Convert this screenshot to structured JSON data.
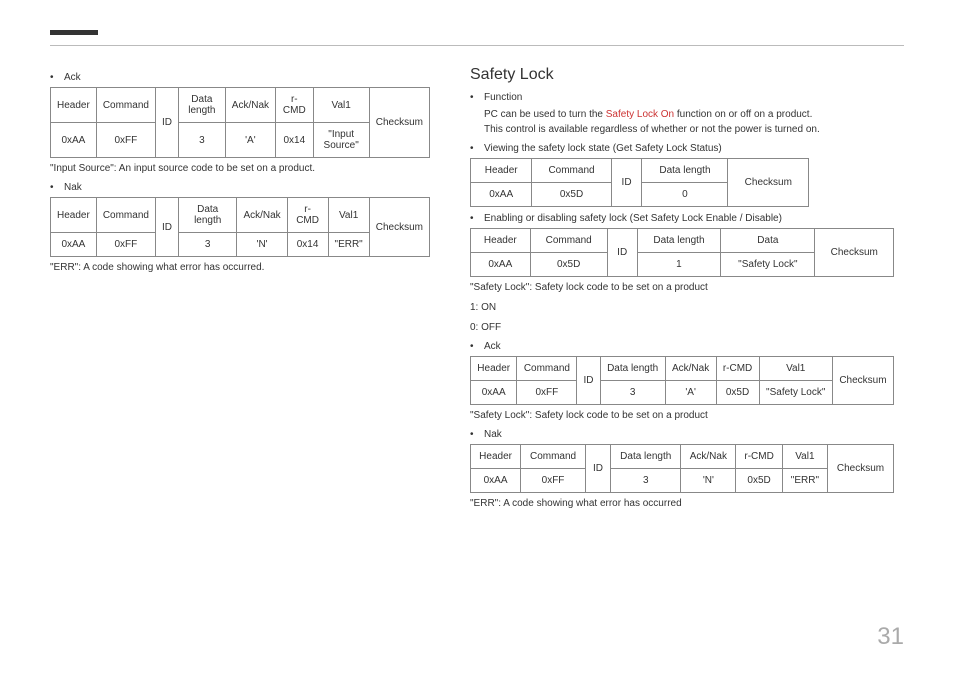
{
  "page_number": "31",
  "left": {
    "ack_label": "Ack",
    "table_ack": {
      "h": [
        "Header",
        "Command",
        "ID",
        "Data length",
        "Ack/Nak",
        "r-CMD",
        "Val1",
        "Checksum"
      ],
      "r": [
        "0xAA",
        "0xFF",
        "",
        "3",
        "'A'",
        "0x14",
        "\"Input Source\""
      ]
    },
    "note1": "\"Input Source\": An input source code to be set on a product.",
    "nak_label": "Nak",
    "table_nak": {
      "h": [
        "Header",
        "Command",
        "ID",
        "Data length",
        "Ack/Nak",
        "r-CMD",
        "Val1",
        "Checksum"
      ],
      "r": [
        "0xAA",
        "0xFF",
        "",
        "3",
        "'N'",
        "0x14",
        "\"ERR\""
      ]
    },
    "note2": "\"ERR\": A code showing what error has occurred."
  },
  "right": {
    "title": "Safety Lock",
    "function_label": "Function",
    "function_line1a": "PC can be used to turn the ",
    "function_line1_red": "Safety Lock On",
    "function_line1b": " function on or off on a product.",
    "function_line2": "This control is available regardless of whether or not the power is turned on.",
    "view_label": "Viewing the safety lock state (Get Safety Lock Status)",
    "table_view": {
      "h": [
        "Header",
        "Command",
        "ID",
        "Data length",
        "Checksum"
      ],
      "r": [
        "0xAA",
        "0x5D",
        "",
        "0"
      ]
    },
    "set_label": "Enabling or disabling safety lock (Set Safety Lock Enable / Disable)",
    "table_set": {
      "h": [
        "Header",
        "Command",
        "ID",
        "Data length",
        "Data",
        "Checksum"
      ],
      "r": [
        "0xAA",
        "0x5D",
        "",
        "1",
        "\"Safety Lock\""
      ]
    },
    "note1": "\"Safety Lock\": Safety lock code to be set on a product",
    "v1": "1: ON",
    "v0": "0: OFF",
    "ack_label": "Ack",
    "table_ack": {
      "h": [
        "Header",
        "Command",
        "ID",
        "Data length",
        "Ack/Nak",
        "r-CMD",
        "Val1",
        "Checksum"
      ],
      "r": [
        "0xAA",
        "0xFF",
        "",
        "3",
        "'A'",
        "0x5D",
        "\"Safety Lock\""
      ]
    },
    "note2": "\"Safety Lock\": Safety lock code to be set on a product",
    "nak_label": "Nak",
    "table_nak": {
      "h": [
        "Header",
        "Command",
        "ID",
        "Data length",
        "Ack/Nak",
        "r-CMD",
        "Val1",
        "Checksum"
      ],
      "r": [
        "0xAA",
        "0xFF",
        "",
        "3",
        "'N'",
        "0x5D",
        "\"ERR\""
      ]
    },
    "note3": "\"ERR\": A code showing what error has occurred"
  }
}
